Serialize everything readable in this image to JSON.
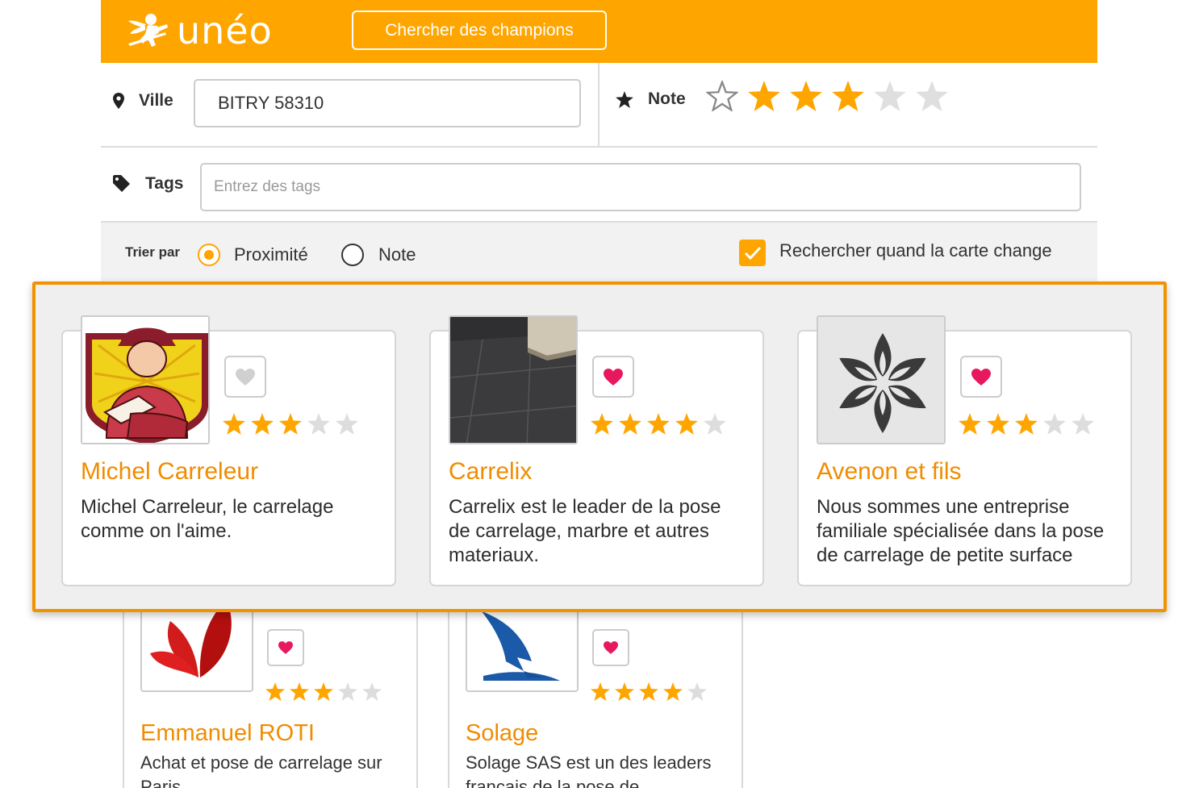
{
  "header": {
    "logo_text": "unéo",
    "search_button_label": "Chercher des champions",
    "bg_color": "#ffa500"
  },
  "filters": {
    "ville_label": "Ville",
    "ville_value": "BITRY 58310",
    "note_label": "Note",
    "note_rating": 3,
    "note_max": 5,
    "tags_label": "Tags",
    "tags_placeholder": "Entrez des tags",
    "sort_label": "Trier par",
    "sort_options": [
      "Proximité",
      "Note"
    ],
    "sort_selected": "Proximité",
    "map_search_label": "Rechercher quand la carte change",
    "map_search_checked": true
  },
  "highlighted_results": [
    {
      "name": "Michel Carreleur",
      "description": "Michel Carreleur, le carrelage comme on l'aime.",
      "rating": 3,
      "favorite": false,
      "image": "tiler-worker-illustration"
    },
    {
      "name": "Carrelix",
      "description": "Carrelix est le leader de la pose de carrelage, marbre et autres materiaux.",
      "rating": 4,
      "favorite": true,
      "image": "dark-tile-floor-photo"
    },
    {
      "name": "Avenon et fils",
      "description": "Nous sommes une entreprise familiale spécialisée dans la pose de carrelage de petite surface",
      "rating": 3,
      "favorite": true,
      "image": "flower-logo"
    }
  ],
  "background_results": [
    {
      "name": "Emmanuel ROTI",
      "description": "Achat et pose de carrelage sur Paris",
      "rating": 3,
      "favorite": true,
      "image": "red-petals-logo"
    },
    {
      "name": "Solage",
      "description": "Solage SAS est un des leaders français de la pose de carrelage",
      "rating": 4,
      "favorite": true,
      "image": "blue-sail-logo"
    }
  ],
  "colors": {
    "accent": "#ffa500",
    "title_orange": "#f08c00",
    "highlight_border": "#f39200",
    "heart_pink": "#e8185f",
    "star_empty": "#dddddd"
  }
}
